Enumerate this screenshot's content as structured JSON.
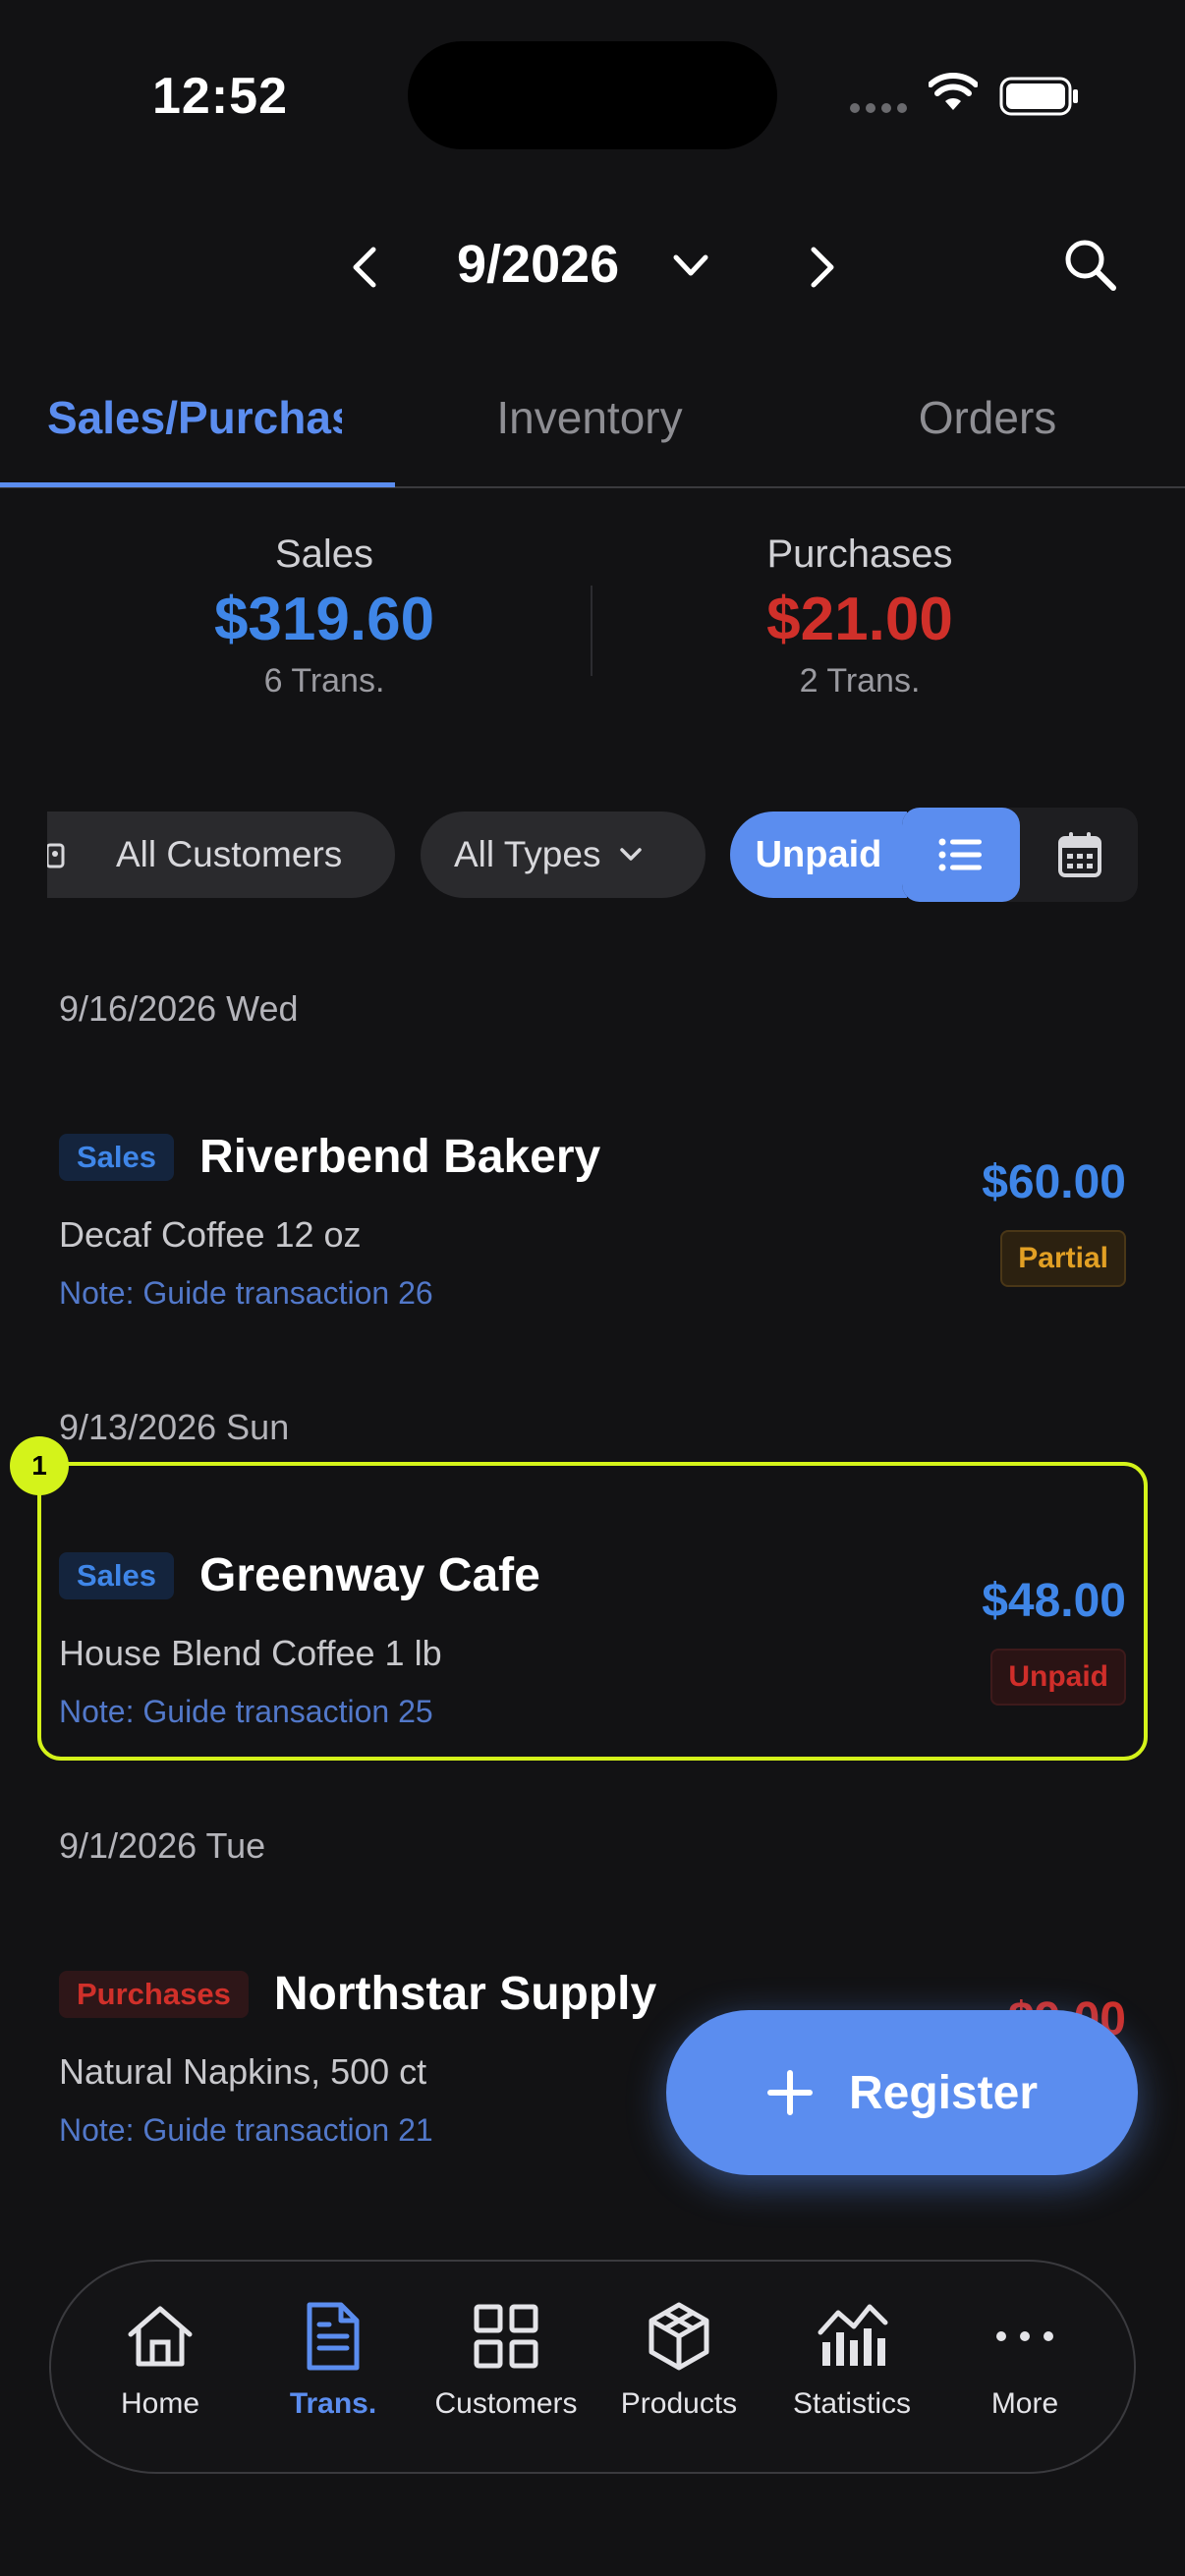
{
  "status_bar": {
    "time": "12:52"
  },
  "header": {
    "month": "9/2026"
  },
  "tabs": [
    {
      "label": "Sales/Purchases",
      "active": true
    },
    {
      "label": "Inventory",
      "active": false
    },
    {
      "label": "Orders",
      "active": false
    }
  ],
  "summary": {
    "sales": {
      "label": "Sales",
      "value": "$319.60",
      "count": "6 Trans."
    },
    "purchases": {
      "label": "Purchases",
      "value": "$21.00",
      "count": "2 Trans."
    }
  },
  "filters": {
    "customers": "All Customers",
    "types": "All Types",
    "payment": "Unpaid"
  },
  "groups": [
    {
      "date": "9/16/2026 Wed",
      "transaction": {
        "type": "Sales",
        "party": "Riverbend Bakery",
        "item": "Decaf Coffee 12 oz",
        "note": "Note: Guide transaction 26",
        "amount": "$60.00",
        "status": "Partial"
      }
    },
    {
      "date": "9/13/2026 Sun",
      "transaction": {
        "type": "Sales",
        "party": "Greenway Cafe",
        "item": "House Blend Coffee 1 lb",
        "note": "Note: Guide transaction 25",
        "amount": "$48.00",
        "status": "Unpaid"
      }
    },
    {
      "date": "9/1/2026 Tue",
      "transaction": {
        "type": "Purchases",
        "party": "Northstar Supply",
        "item": "Natural Napkins, 500 ct",
        "note": "Note: Guide transaction 21",
        "amount": "$9.00"
      }
    }
  ],
  "highlight_label": "1",
  "fab": {
    "label": "Register"
  },
  "nav": [
    {
      "label": "Home",
      "icon": "home-icon"
    },
    {
      "label": "Trans.",
      "icon": "document-icon",
      "active": true
    },
    {
      "label": "Customers",
      "icon": "grid-icon"
    },
    {
      "label": "Products",
      "icon": "box-icon"
    },
    {
      "label": "Statistics",
      "icon": "chart-icon"
    },
    {
      "label": "More",
      "icon": "more-icon"
    }
  ],
  "colors": {
    "accent": "#5b8def",
    "sales": "#3f86e8",
    "purchases": "#d0302a",
    "highlight": "#d4f31a"
  }
}
